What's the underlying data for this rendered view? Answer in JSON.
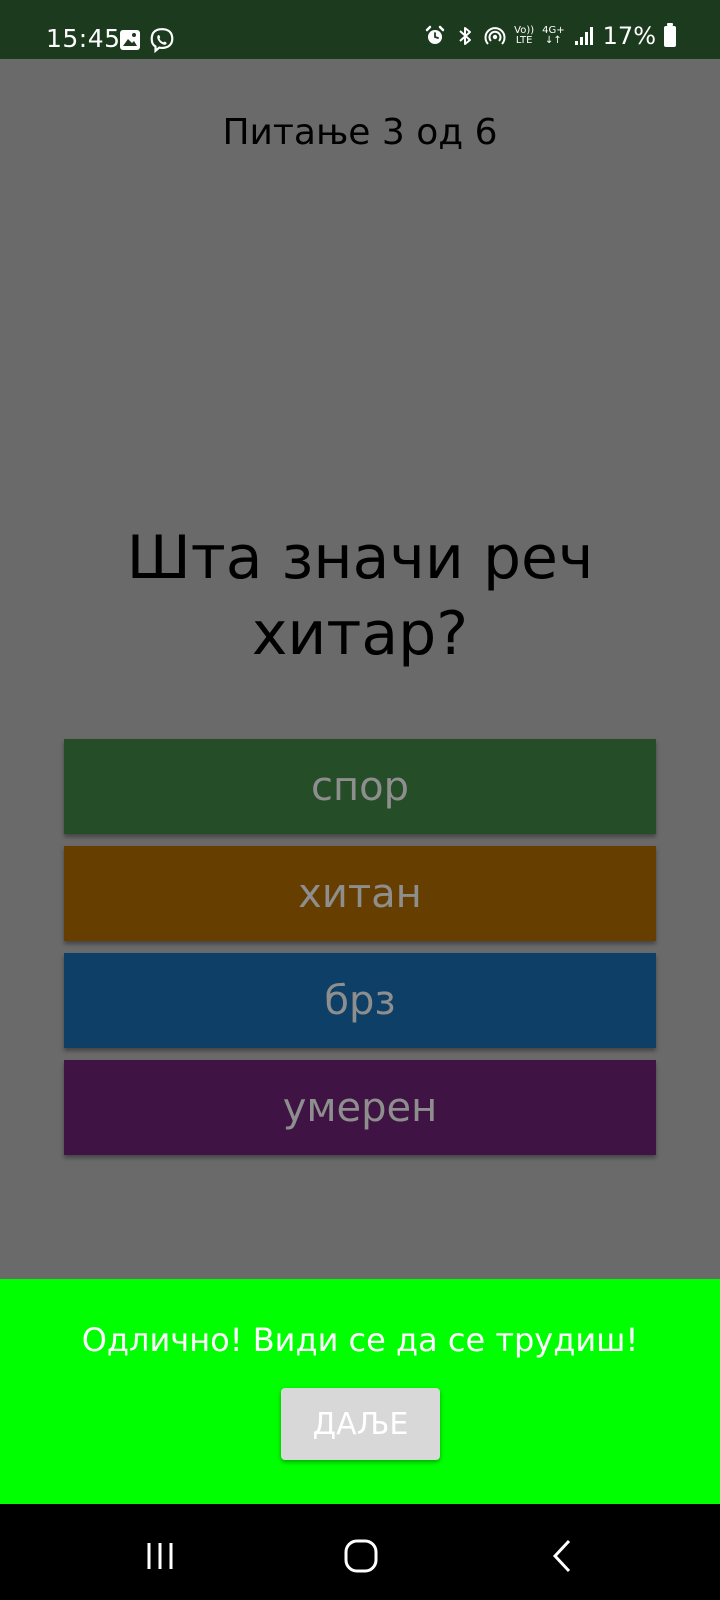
{
  "status_bar": {
    "time": "15:45",
    "left_icons": [
      "gallery-icon",
      "viber-icon"
    ],
    "right_icons": [
      "alarm-icon",
      "bluetooth-icon",
      "hotspot-icon",
      "volte-icon",
      "4g-plus-icon",
      "signal-icon",
      "battery-icon"
    ],
    "volte_top": "Vo))",
    "volte_bottom": "LTE",
    "net_top": "4G+",
    "net_bottom": "↓↑",
    "battery_percent": "17%"
  },
  "quiz": {
    "counter": "Питање 3 од 6",
    "question": "Шта значи реч хитар?",
    "answers": [
      {
        "label": "спор",
        "color": "#254d27"
      },
      {
        "label": "хитан",
        "color": "#663f00"
      },
      {
        "label": "брз",
        "color": "#0e3f66"
      },
      {
        "label": "умерен",
        "color": "#3f1344"
      }
    ]
  },
  "feedback": {
    "message": "Одлично! Види се да се трудиш!",
    "next_label": "ДАЉЕ",
    "background": "#00ff00"
  },
  "nav_bar": {
    "buttons": [
      "recent-apps-icon",
      "home-icon",
      "back-icon"
    ]
  }
}
